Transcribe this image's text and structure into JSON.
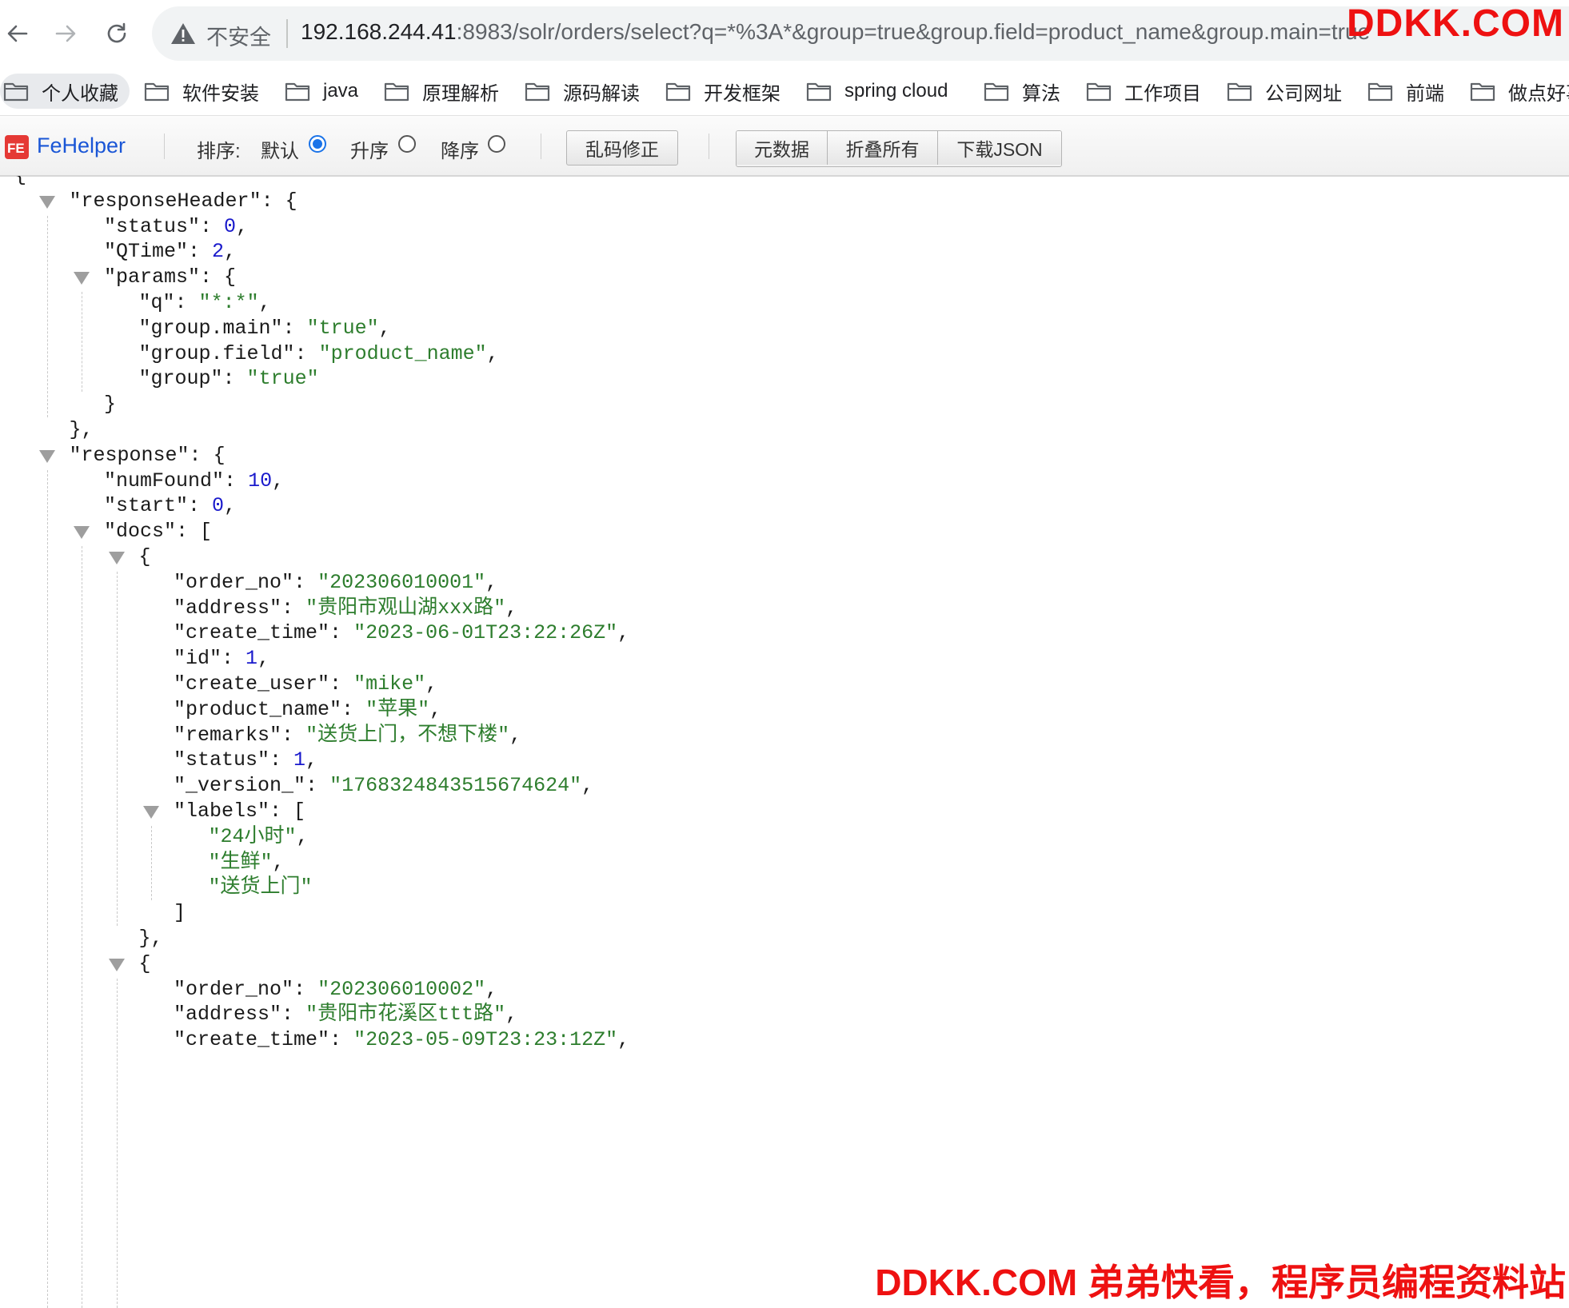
{
  "address_bar": {
    "security_label": "不安全",
    "url_host": "192.168.244.41",
    "url_rest": ":8983/solr/orders/select?q=*%3A*&group=true&group.field=product_name&group.main=true"
  },
  "watermark": {
    "top": "DDKK.COM",
    "bottom": "DDKK.COM 弟弟快看，程序员编程资料站"
  },
  "bookmarks": [
    "个人收藏",
    "软件安装",
    "java",
    "原理解析",
    "源码解读",
    "开发框架",
    "spring cloud",
    "算法",
    "工作项目",
    "公司网址",
    "前端",
    "做点好事"
  ],
  "fehelper": {
    "brand": "FeHelper",
    "sort_label": "排序:",
    "sort_default": "默认",
    "sort_asc": "升序",
    "sort_desc": "降序",
    "sort_selected": "默认",
    "fix_encoding": "乱码修正",
    "metadata": "元数据",
    "collapse_all": "折叠所有",
    "download_json": "下载JSON"
  },
  "json_lines": [
    {
      "indent": 0,
      "open": "{"
    },
    {
      "indent": 1,
      "key": "responseHeader",
      "open": "{",
      "collapsible": true
    },
    {
      "indent": 2,
      "key": "status",
      "num": "0",
      "comma": true
    },
    {
      "indent": 2,
      "key": "QTime",
      "num": "2",
      "comma": true
    },
    {
      "indent": 2,
      "key": "params",
      "open": "{",
      "collapsible": true
    },
    {
      "indent": 3,
      "key": "q",
      "str": "*:*",
      "comma": true
    },
    {
      "indent": 3,
      "key": "group.main",
      "str": "true",
      "comma": true
    },
    {
      "indent": 3,
      "key": "group.field",
      "str": "product_name",
      "comma": true
    },
    {
      "indent": 3,
      "key": "group",
      "str": "true"
    },
    {
      "indent": 2,
      "close": "}"
    },
    {
      "indent": 1,
      "close": "},"
    },
    {
      "indent": 1,
      "key": "response",
      "open": "{",
      "collapsible": true
    },
    {
      "indent": 2,
      "key": "numFound",
      "num": "10",
      "comma": true
    },
    {
      "indent": 2,
      "key": "start",
      "num": "0",
      "comma": true
    },
    {
      "indent": 2,
      "key": "docs",
      "open": "[",
      "collapsible": true
    },
    {
      "indent": 3,
      "open": "{",
      "collapsible": true
    },
    {
      "indent": 4,
      "key": "order_no",
      "str": "202306010001",
      "comma": true
    },
    {
      "indent": 4,
      "key": "address",
      "str": "贵阳市观山湖xxx路",
      "comma": true
    },
    {
      "indent": 4,
      "key": "create_time",
      "str": "2023-06-01T23:22:26Z",
      "comma": true
    },
    {
      "indent": 4,
      "key": "id",
      "num": "1",
      "comma": true
    },
    {
      "indent": 4,
      "key": "create_user",
      "str": "mike",
      "comma": true
    },
    {
      "indent": 4,
      "key": "product_name",
      "str": "苹果",
      "comma": true
    },
    {
      "indent": 4,
      "key": "remarks",
      "str": "送货上门，不想下楼",
      "comma": true
    },
    {
      "indent": 4,
      "key": "status",
      "num": "1",
      "comma": true
    },
    {
      "indent": 4,
      "key": "_version_",
      "str": "1768324843515674624",
      "comma": true
    },
    {
      "indent": 4,
      "key": "labels",
      "open": "[",
      "collapsible": true
    },
    {
      "indent": 5,
      "str": "24小时",
      "comma": true
    },
    {
      "indent": 5,
      "str": "生鲜",
      "comma": true
    },
    {
      "indent": 5,
      "str": "送货上门"
    },
    {
      "indent": 4,
      "close": "]"
    },
    {
      "indent": 3,
      "close": "},"
    },
    {
      "indent": 3,
      "open": "{",
      "collapsible": true
    },
    {
      "indent": 4,
      "key": "order_no",
      "str": "202306010002",
      "comma": true
    },
    {
      "indent": 4,
      "key": "address",
      "str": "贵阳市花溪区ttt路",
      "comma": true
    },
    {
      "indent": 4,
      "key": "create_time",
      "str": "2023-05-09T23:23:12Z",
      "comma": true
    }
  ]
}
